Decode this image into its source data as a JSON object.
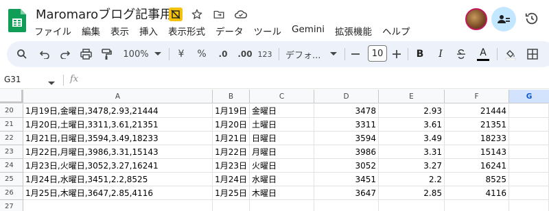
{
  "doc": {
    "title": "Maromaroブログ記事用"
  },
  "title_icons": [
    "no-offline-icon",
    "star-icon",
    "move-folder-icon",
    "cloud-saved-icon"
  ],
  "menu": [
    "ファイル",
    "編集",
    "表示",
    "挿入",
    "表示形式",
    "データ",
    "ツール",
    "Gemini",
    "拡張機能",
    "ヘルプ"
  ],
  "toolbar": {
    "zoom": "100%",
    "currency": "¥",
    "percent": "%",
    "decrease_decimal": ".0",
    "increase_decimal": ".00",
    "format_123": "123",
    "font": "デフォ...",
    "font_size": "10",
    "bold": "B",
    "italic": "I",
    "text_color": "A"
  },
  "formula_bar": {
    "name_box": "G31",
    "fx": "fx",
    "value": ""
  },
  "columns": [
    "A",
    "B",
    "C",
    "D",
    "E",
    "F",
    "G"
  ],
  "rows": [
    {
      "num": "20",
      "a": "1月19日,金曜日,3478,2.93,21444",
      "b": "1月19日",
      "c": "金曜日",
      "d": "3478",
      "e": "2.93",
      "f": "21444"
    },
    {
      "num": "21",
      "a": "1月20日,土曜日,3311,3.61,21351",
      "b": "1月20日",
      "c": "土曜日",
      "d": "3311",
      "e": "3.61",
      "f": "21351"
    },
    {
      "num": "22",
      "a": "1月21日,日曜日,3594,3.49,18233",
      "b": "1月21日",
      "c": "日曜日",
      "d": "3594",
      "e": "3.49",
      "f": "18233"
    },
    {
      "num": "23",
      "a": "1月22日,月曜日,3986,3.31,15143",
      "b": "1月22日",
      "c": "月曜日",
      "d": "3986",
      "e": "3.31",
      "f": "15143"
    },
    {
      "num": "24",
      "a": "1月23日,火曜日,3052,3.27,16241",
      "b": "1月23日",
      "c": "火曜日",
      "d": "3052",
      "e": "3.27",
      "f": "16241"
    },
    {
      "num": "25",
      "a": "1月24日,水曜日,3451,2.2,8525",
      "b": "1月24日",
      "c": "水曜日",
      "d": "3451",
      "e": "2.2",
      "f": "8525"
    },
    {
      "num": "26",
      "a": "1月25日,木曜日,3647,2.85,4116",
      "b": "1月25日",
      "c": "木曜日",
      "d": "3647",
      "e": "2.85",
      "f": "4116"
    },
    {
      "num": "27",
      "a": "",
      "b": "",
      "c": "",
      "d": "",
      "e": "",
      "f": ""
    }
  ],
  "colors": {
    "accent": "#0b57d0",
    "toolbar_bg": "#edf2fa",
    "selected_header_bg": "#d3e3fd",
    "sheets_green": "#0f9d58"
  }
}
